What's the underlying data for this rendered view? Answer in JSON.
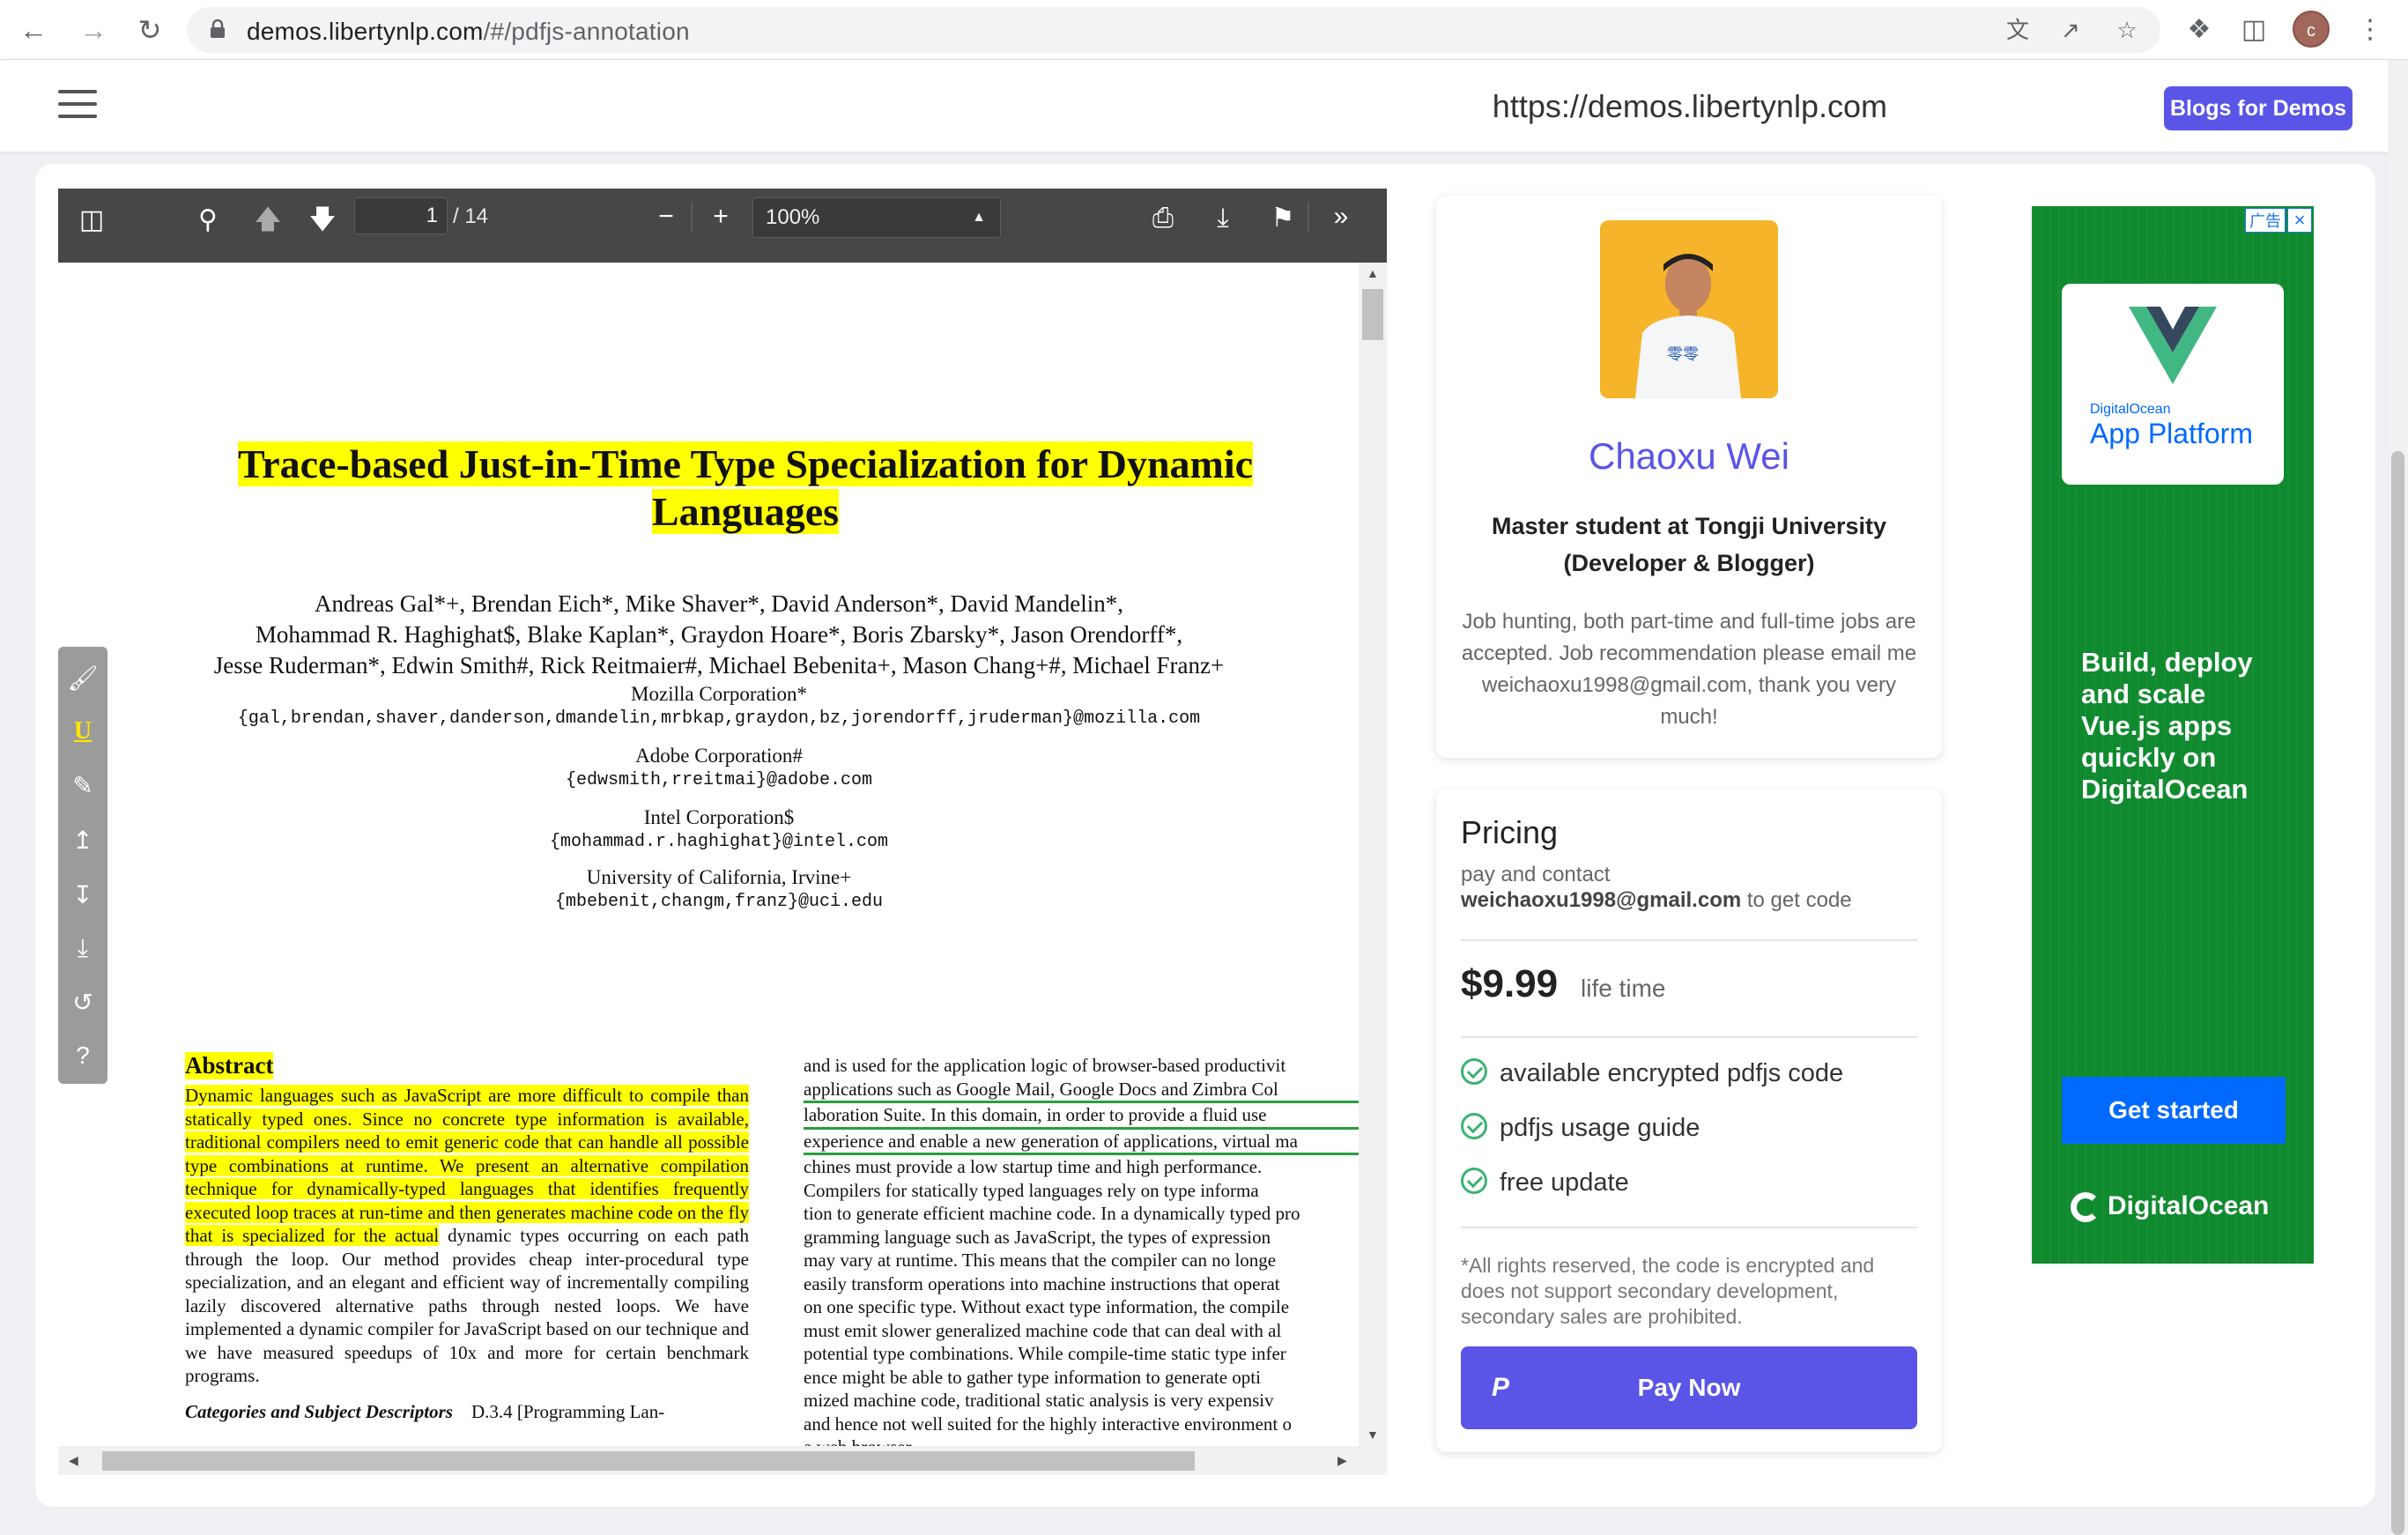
{
  "browser": {
    "url_host": "demos.libertynlp.com",
    "url_path": "/#/pdfjs-annotation",
    "profile_initial": "c"
  },
  "site": {
    "site_url": "https://demos.libertynlp.com",
    "blogs_label": "Blogs for Demos"
  },
  "pdf_toolbar": {
    "page_number": "1",
    "page_count": "/ 14",
    "zoom": "100%"
  },
  "paper": {
    "title_line1": "Trace-based Just-in-Time Type Specialization for Dynamic",
    "title_line2": "Languages",
    "authors_line1": "Andreas Gal*+, Brendan Eich*, Mike Shaver*, David Anderson*, David Mandelin*,",
    "authors_line2": "Mohammad R. Haghighat$, Blake Kaplan*, Graydon Hoare*, Boris Zbarsky*, Jason Orendorff*,",
    "authors_line3": "Jesse Ruderman*, Edwin Smith#, Rick Reitmaier#, Michael Bebenita+, Mason Chang+#, Michael Franz+",
    "affiliations": [
      {
        "org": "Mozilla Corporation*",
        "emails": "{gal,brendan,shaver,danderson,dmandelin,mrbkap,graydon,bz,jorendorff,jruderman}@mozilla.com"
      },
      {
        "org": "Adobe Corporation#",
        "emails": "{edwsmith,rreitmai}@adobe.com"
      },
      {
        "org": "Intel Corporation$",
        "emails": "{mohammad.r.haghighat}@intel.com"
      },
      {
        "org": "University of California, Irvine+",
        "emails": "{mbebenit,changm,franz}@uci.edu"
      }
    ],
    "abstract_heading": "Abstract",
    "abstract_highlighted": "Dynamic languages such as JavaScript are more difficult to compile than statically typed ones. Since no concrete type information is available, traditional compilers need to emit generic code that can handle all possible type combinations at runtime. We present an alternative compilation technique for dynamically-typed languages that identifies frequently executed loop traces at run-time and then generates machine code on the fly that is specialized for the actual",
    "abstract_rest": " dynamic types occurring on each path through the loop. Our method provides cheap inter-procedural type specialization, and an elegant and efficient way of incrementally compiling lazily discovered alternative paths through nested loops. We have implemented a dynamic compiler for JavaScript based on our technique and we have measured speedups of 10x and more for certain benchmark programs.",
    "categories": "Categories and Subject Descriptors",
    "categories_rest": "D.3.4 [Programming Lan-",
    "right_col": [
      "and is used for the application logic of browser-based productivit",
      "applications such as Google Mail, Google Docs and Zimbra Col",
      "laboration Suite. In this domain, in order to provide a fluid use",
      "experience and enable a new generation of applications, virtual ma",
      "chines must provide a low startup time and high performance.",
      "     Compilers for statically typed languages rely on type informa",
      "tion to generate efficient machine code. In a dynamically typed pro",
      "gramming language such as JavaScript, the types of expression",
      "may vary at runtime. This means that the compiler can no longe",
      "easily transform operations into machine instructions that operat",
      "on one specific type. Without exact type information, the compile",
      "must emit slower generalized machine code that can deal with al",
      "potential type combinations. While compile-time static type infer",
      "ence might be able to gather type information to generate opti",
      "mized machine code, traditional static analysis is very expensiv",
      "and hence not well suited for the highly interactive environment o",
      "a web browser."
    ]
  },
  "profile": {
    "name": "Chaoxu Wei",
    "role": "Master student at Tongji University (Developer & Blogger)",
    "description": "Job hunting, both part-time and full-time jobs are accepted. Job recommendation please email me weichaoxu1998@gmail.com, thank you very much!"
  },
  "pricing": {
    "title": "Pricing",
    "contact_prefix": "pay and contact",
    "contact_email": "weichaoxu1998@gmail.com",
    "contact_suffix": "to get code",
    "price": "$9.99",
    "price_note": "life time",
    "features": [
      "available encrypted pdfjs code",
      "pdfjs usage guide",
      "free update"
    ],
    "rights": "*All rights reserved, the code is encrypted and does not support secondary development, secondary sales are prohibited.",
    "pay_label": "Pay Now"
  },
  "ad": {
    "badge": "广告",
    "tile_small": "DigitalOcean",
    "tile_big": "App Platform",
    "headline": "Build, deploy and scale Vue.js apps quickly on DigitalOcean",
    "cta": "Get started",
    "brand": "DigitalOcean"
  },
  "colors": {
    "accent": "#5a55e6",
    "highlight": "#ffff00",
    "underline": "#2a9d3f",
    "ad_bg": "#0f8a2e",
    "ad_cta": "#0069ff"
  }
}
